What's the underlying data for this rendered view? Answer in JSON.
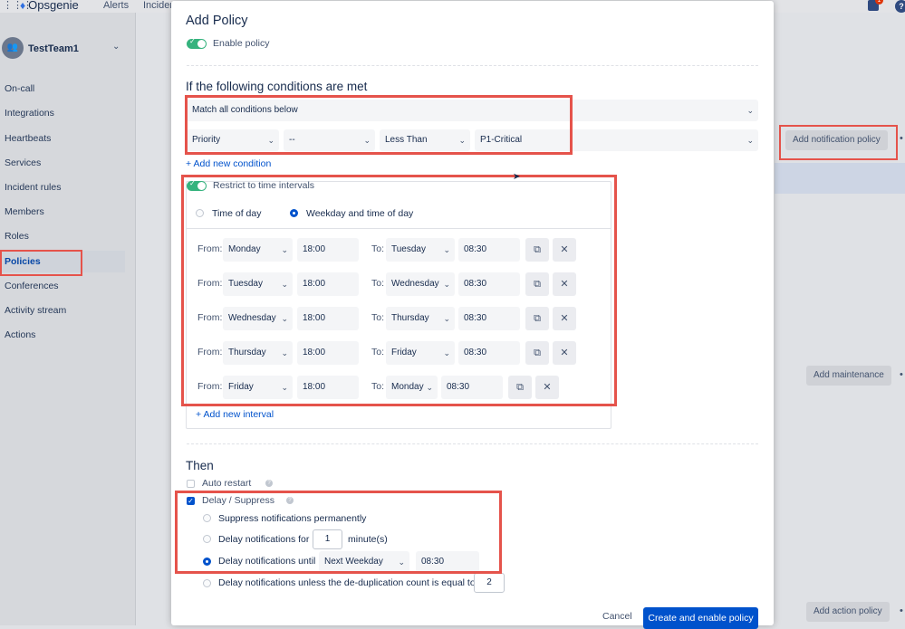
{
  "topbar": {
    "app_name": "Opsgenie",
    "nav": [
      "Alerts",
      "Inciden"
    ],
    "notification_count": "1",
    "help": "?"
  },
  "sidebar": {
    "team": "TestTeam1",
    "items": [
      {
        "label": "On-call"
      },
      {
        "label": "Integrations"
      },
      {
        "label": "Heartbeats"
      },
      {
        "label": "Services"
      },
      {
        "label": "Incident rules"
      },
      {
        "label": "Members"
      },
      {
        "label": "Roles"
      },
      {
        "label": "Policies"
      },
      {
        "label": "Conferences"
      },
      {
        "label": "Activity stream"
      },
      {
        "label": "Actions"
      }
    ]
  },
  "background": {
    "add_notification_policy": "Add notification policy",
    "add_maintenance": "Add maintenance",
    "add_action_policy": "Add action policy"
  },
  "modal": {
    "title": "Add Policy",
    "enable_policy": "Enable policy",
    "conditions_heading": "If the following conditions are met",
    "match_select": "Match all conditions below",
    "condition": {
      "field": "Priority",
      "not": "--",
      "operator": "Less Than",
      "value": "P1-Critical"
    },
    "add_condition": "+ Add new condition",
    "restrict_label": "Restrict to time intervals",
    "time_of_day": "Time of day",
    "weekday_time": "Weekday and time of day",
    "from_label": "From:",
    "to_label": "To:",
    "intervals": [
      {
        "from_day": "Monday",
        "from_time": "18:00",
        "to_day": "Tuesday",
        "to_time": "08:30"
      },
      {
        "from_day": "Tuesday",
        "from_time": "18:00",
        "to_day": "Wednesday",
        "to_time": "08:30"
      },
      {
        "from_day": "Wednesday",
        "from_time": "18:00",
        "to_day": "Thursday",
        "to_time": "08:30"
      },
      {
        "from_day": "Thursday",
        "from_time": "18:00",
        "to_day": "Friday",
        "to_time": "08:30"
      },
      {
        "from_day": "Friday",
        "from_time": "18:00",
        "to_day": "Monday",
        "to_time": "08:30"
      }
    ],
    "add_interval": "+ Add new interval",
    "then_heading": "Then",
    "auto_restart": "Auto restart",
    "delay_suppress": "Delay / Suppress",
    "suppress_permanently": "Suppress notifications permanently",
    "delay_for": "Delay notifications for",
    "delay_for_value": "1",
    "minutes": "minute(s)",
    "delay_until": "Delay notifications until",
    "delay_until_select": "Next Weekday",
    "delay_until_time": "08:30",
    "delay_unless": "Delay notifications unless the de-duplication count is equal to",
    "dedup_value": "2",
    "cancel": "Cancel",
    "create": "Create and enable policy"
  },
  "colors": {
    "accent": "#0052cc",
    "highlight": "#e5534b",
    "toggle_on": "#36b37e"
  }
}
